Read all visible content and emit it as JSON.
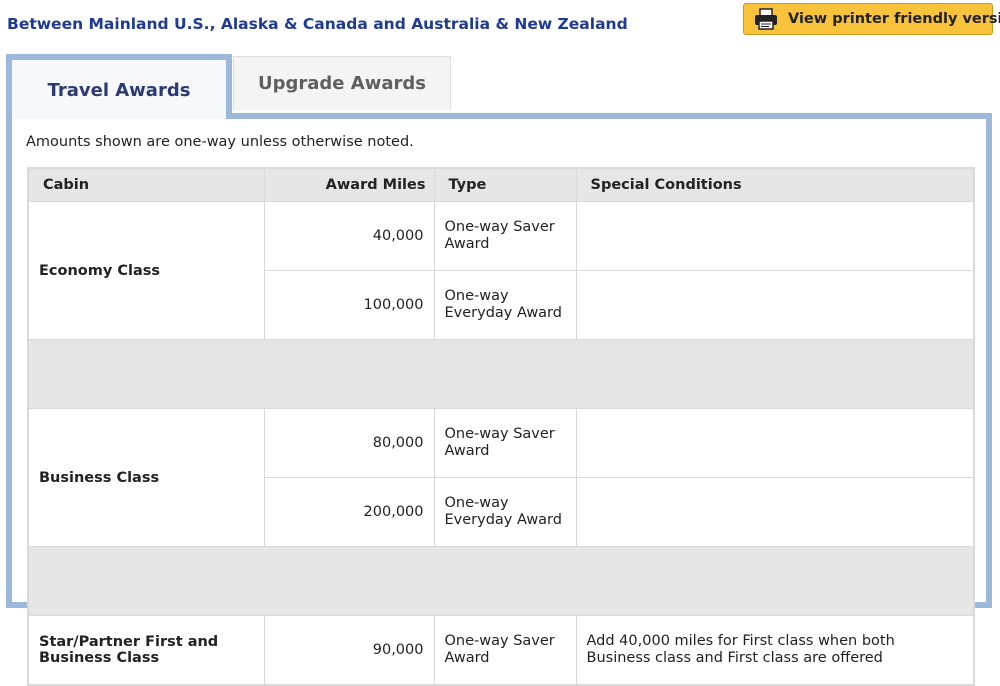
{
  "page_title": "Between Mainland U.S., Alaska & Canada and Australia & New Zealand",
  "print_button": {
    "label": "View printer friendly version",
    "icon": "printer-icon"
  },
  "tabs": [
    {
      "label": "Travel Awards",
      "active": true
    },
    {
      "label": "Upgrade Awards",
      "active": false
    }
  ],
  "note": "Amounts shown are one-way unless otherwise noted.",
  "table": {
    "headers": {
      "cabin": "Cabin",
      "miles": "Award Miles",
      "type": "Type",
      "conditions": "Special Conditions"
    },
    "groups": [
      {
        "cabin": "Economy Class",
        "rows": [
          {
            "miles": "40,000",
            "type": "One-way Saver Award",
            "conditions": ""
          },
          {
            "miles": "100,000",
            "type": "One-way Everyday Award",
            "conditions": ""
          }
        ]
      },
      {
        "cabin": "Business Class",
        "rows": [
          {
            "miles": "80,000",
            "type": "One-way Saver Award",
            "conditions": ""
          },
          {
            "miles": "200,000",
            "type": "One-way Everyday Award",
            "conditions": ""
          }
        ]
      },
      {
        "cabin": "Star/Partner First and Business Class",
        "rows": [
          {
            "miles": "90,000",
            "type": "One-way Saver Award",
            "conditions": "Add 40,000 miles for First class when both Business class and First class are offered"
          }
        ]
      }
    ]
  },
  "colors": {
    "title": "#1f3a93",
    "button_bg": "#f8c33a",
    "tab_border": "#9cb9dc",
    "header_bg": "#e6e6e6"
  }
}
